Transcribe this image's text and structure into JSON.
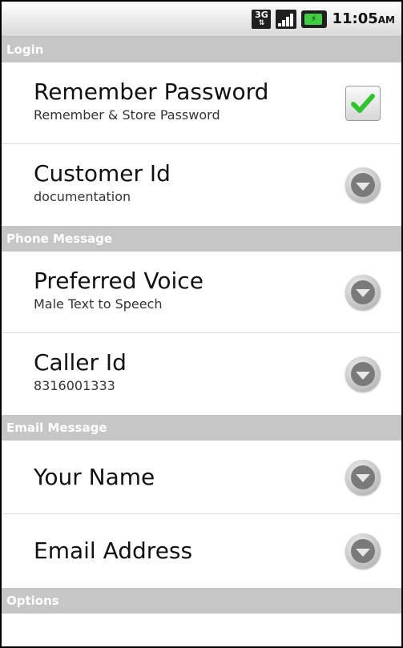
{
  "status_bar": {
    "network_label": "3G",
    "battery_symbol": "⚡",
    "time": "11:05",
    "ampm": "AM"
  },
  "sections": {
    "login": "Login",
    "phone_message": "Phone Message",
    "email_message": "Email Message",
    "options": "Options"
  },
  "login": {
    "remember_password": {
      "title": "Remember Password",
      "summary": "Remember & Store Password",
      "checked": true
    },
    "customer_id": {
      "title": "Customer Id",
      "summary": "documentation"
    }
  },
  "phone_message": {
    "preferred_voice": {
      "title": "Preferred Voice",
      "summary": "Male Text to Speech"
    },
    "caller_id": {
      "title": "Caller Id",
      "summary": "8316001333"
    }
  },
  "email_message": {
    "your_name": {
      "title": "Your Name"
    },
    "email_address": {
      "title": "Email Address"
    }
  },
  "colors": {
    "section_bg": "#c6c6c6",
    "check_green": "#2ec42e"
  }
}
